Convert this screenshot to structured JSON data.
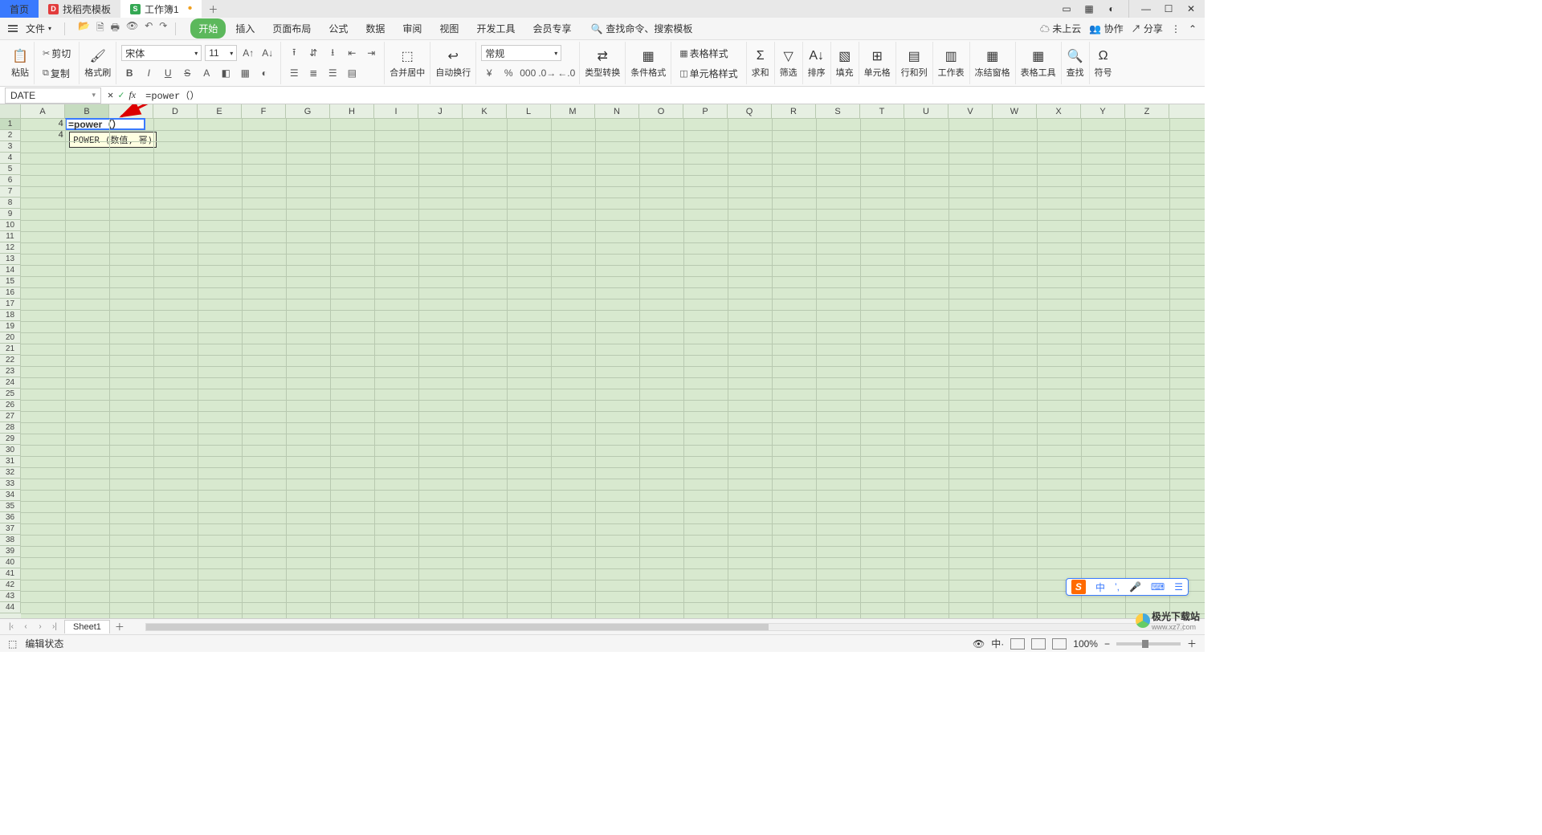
{
  "titlebar": {
    "tabs": [
      {
        "label": "首页",
        "active": true
      },
      {
        "label": "找稻壳模板",
        "icon": "D"
      },
      {
        "label": "工作簿1",
        "icon": "S",
        "doc": true
      }
    ]
  },
  "menubar": {
    "file": "文件",
    "qat": [
      "📂",
      "🗋",
      "🖶",
      "🖨",
      "↶",
      "↷"
    ],
    "tabs": [
      "开始",
      "插入",
      "页面布局",
      "公式",
      "数据",
      "审阅",
      "视图",
      "开发工具",
      "会员专享"
    ],
    "active_tab": "开始",
    "search": "查找命令、搜索模板",
    "right": {
      "cloud": "未上云",
      "collab": "协作",
      "share": "分享"
    }
  },
  "ribbon": {
    "paste": "粘贴",
    "cut": "剪切",
    "copy": "复制",
    "format_painter": "格式刷",
    "font_name": "宋体",
    "font_size": "11",
    "merge": "合并居中",
    "wrap": "自动换行",
    "num_format": "常规",
    "type_convert": "类型转换",
    "cond_format": "条件格式",
    "table_style": "表格样式",
    "cell_style": "单元格样式",
    "sum": "求和",
    "filter": "筛选",
    "sort": "排序",
    "fill": "填充",
    "cells": "单元格",
    "rowcol": "行和列",
    "sheet": "工作表",
    "freeze": "冻结窗格",
    "tabletools": "表格工具",
    "find": "查找",
    "symbol": "符号"
  },
  "formula_bar": {
    "name_box": "DATE",
    "formula": "=power（）"
  },
  "columns": [
    "A",
    "B",
    "C",
    "D",
    "E",
    "F",
    "G",
    "H",
    "I",
    "J",
    "K",
    "L",
    "M",
    "N",
    "O",
    "P",
    "Q",
    "R",
    "S",
    "T",
    "U",
    "V",
    "W",
    "X",
    "Y",
    "Z"
  ],
  "active_col": "B",
  "active_row": 1,
  "rows_shown": 44,
  "cells": {
    "A1": "4",
    "A2": "4",
    "B1": "=power（）"
  },
  "tooltip": "POWER (数值, 幂)",
  "sheets": [
    "Sheet1"
  ],
  "status": {
    "mode": "编辑状态",
    "zoom": "100%"
  },
  "ime": {
    "items": [
      "中",
      "’,",
      "🎤",
      "⌨",
      "⚙"
    ]
  },
  "watermark": {
    "brand": "极光下载站",
    "url": "www.xz7.com"
  }
}
